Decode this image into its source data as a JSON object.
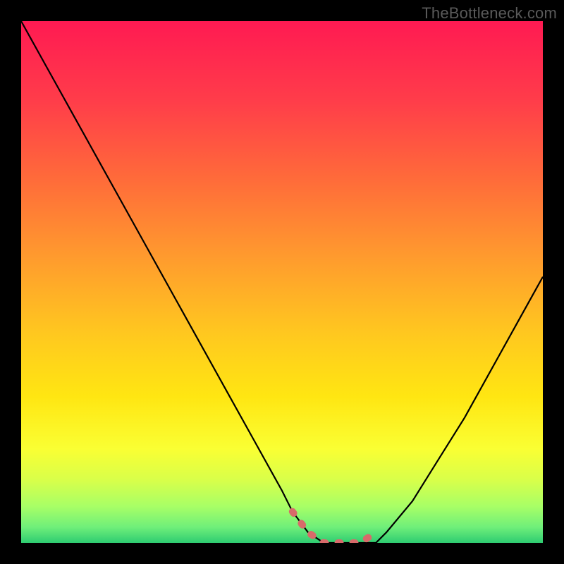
{
  "watermark": "TheBottleneck.com",
  "chart_data": {
    "type": "line",
    "title": "",
    "xlabel": "",
    "ylabel": "",
    "xlim": [
      0,
      100
    ],
    "ylim": [
      0,
      100
    ],
    "series": [
      {
        "name": "curve",
        "x": [
          0,
          5,
          10,
          15,
          20,
          25,
          30,
          35,
          40,
          45,
          50,
          52,
          55,
          58,
          60,
          63,
          65,
          68,
          70,
          75,
          80,
          85,
          90,
          95,
          100
        ],
        "y": [
          100,
          91,
          82,
          73,
          64,
          55,
          46,
          37,
          28,
          19,
          10,
          6,
          2,
          0,
          0,
          0,
          0,
          0,
          2,
          8,
          16,
          24,
          33,
          42,
          51
        ]
      },
      {
        "name": "accent-segment",
        "x": [
          52,
          55,
          58,
          60,
          63,
          65,
          68
        ],
        "y": [
          6,
          2,
          0,
          0,
          0,
          0,
          2
        ]
      }
    ],
    "gradient": {
      "stops": [
        {
          "offset": 0.0,
          "color": "#ff1a52"
        },
        {
          "offset": 0.15,
          "color": "#ff3c4a"
        },
        {
          "offset": 0.3,
          "color": "#ff6a3a"
        },
        {
          "offset": 0.45,
          "color": "#ff9a2e"
        },
        {
          "offset": 0.6,
          "color": "#ffc81f"
        },
        {
          "offset": 0.72,
          "color": "#ffe612"
        },
        {
          "offset": 0.82,
          "color": "#faff33"
        },
        {
          "offset": 0.88,
          "color": "#d8ff4a"
        },
        {
          "offset": 0.93,
          "color": "#a8ff66"
        },
        {
          "offset": 0.97,
          "color": "#6fef7a"
        },
        {
          "offset": 1.0,
          "color": "#2ecc71"
        }
      ]
    },
    "colors": {
      "curve": "#000000",
      "accent": "#d86a6a"
    }
  }
}
